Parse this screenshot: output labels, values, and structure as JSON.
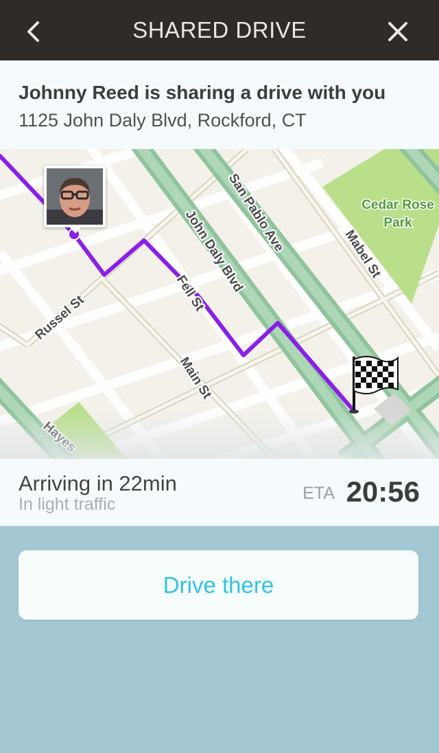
{
  "header": {
    "title": "SHARED DRIVE",
    "back_icon": "chevron-left-icon",
    "close_icon": "close-icon",
    "background": "#2f2b28"
  },
  "info": {
    "title": "Johnny Reed is sharing a drive with you",
    "address": "1125 John Daly Blvd, Rockford, CT"
  },
  "map": {
    "route_color": "#8a1fe8",
    "streets": [
      "Russel St",
      "Fell St",
      "Main St",
      "John Daly Blvd",
      "San Pablo Ave",
      "Mabel St",
      "Hayes"
    ],
    "park": "Cedar Rose Park",
    "destination_icon": "checkered-flag-icon"
  },
  "eta": {
    "arriving": "Arriving in 22min",
    "traffic": "In light traffic",
    "label": "ETA",
    "time": "20:56"
  },
  "action": {
    "drive_label": "Drive there",
    "accent": "#2fc4e0"
  }
}
